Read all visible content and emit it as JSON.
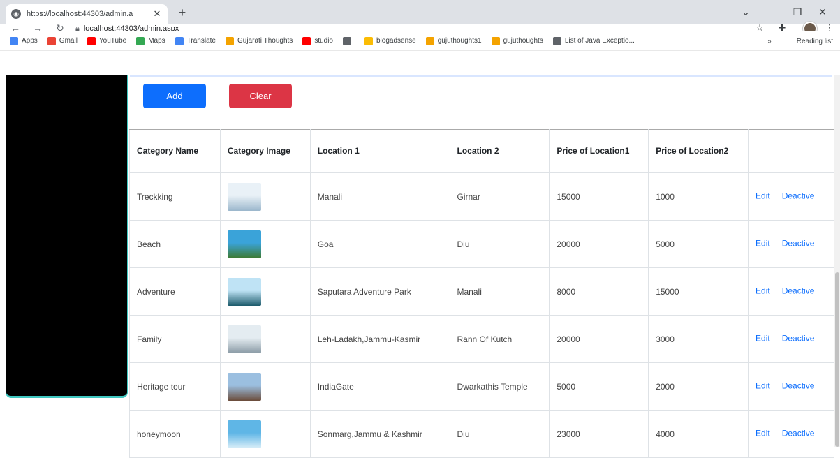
{
  "browser": {
    "tab_title": "https://localhost:44303/admin.a",
    "tab_close": "✕",
    "new_tab": "+",
    "url": "localhost:44303/admin.aspx",
    "window_controls": [
      "⌄",
      "–",
      "❐",
      "✕"
    ],
    "bookmarks": [
      {
        "label": "Apps",
        "icon": "apps-icon",
        "color": "#4285f4"
      },
      {
        "label": "Gmail",
        "icon": "gmail-icon",
        "color": "#ea4335"
      },
      {
        "label": "YouTube",
        "icon": "youtube-icon",
        "color": "#ff0000"
      },
      {
        "label": "Maps",
        "icon": "maps-icon",
        "color": "#34a853"
      },
      {
        "label": "Translate",
        "icon": "translate-icon",
        "color": "#4285f4"
      },
      {
        "label": "Gujarati Thoughts",
        "icon": "blogger-icon",
        "color": "#f4a300"
      },
      {
        "label": "studio",
        "icon": "youtube-studio-icon",
        "color": "#ff0000"
      },
      {
        "label": "",
        "icon": "globe-icon",
        "color": "#5f6368"
      },
      {
        "label": "blogadsense",
        "icon": "adsense-icon",
        "color": "#fbbc04"
      },
      {
        "label": "gujuthoughts1",
        "icon": "blogger-icon",
        "color": "#f4a300"
      },
      {
        "label": "gujuthoughts",
        "icon": "blogger-icon",
        "color": "#f4a300"
      },
      {
        "label": "List of Java Exceptio...",
        "icon": "java-icon",
        "color": "#5f6368"
      }
    ],
    "more_bookmarks": "»",
    "reading_list": "Reading list"
  },
  "actions": {
    "add_label": "Add",
    "clear_label": "Clear"
  },
  "table": {
    "headers": [
      "Category Name",
      "Category Image",
      "Location 1",
      "Location 2",
      "Price of Location1",
      "Price of Location2",
      ""
    ],
    "rows": [
      {
        "name": "Treckking",
        "loc1": "Manali",
        "loc2": "Girnar",
        "price1": "15000",
        "price2": "1000",
        "edit": "Edit",
        "deactive": "Deactive",
        "img_colors": [
          "#e9f1f7",
          "#9bb7cc"
        ]
      },
      {
        "name": "Beach",
        "loc1": "Goa",
        "loc2": "Diu",
        "price1": "20000",
        "price2": "5000",
        "edit": "Edit",
        "deactive": "Deactive",
        "img_colors": [
          "#3aa3d9",
          "#3d7a2f"
        ]
      },
      {
        "name": "Adventure",
        "loc1": "Saputara Adventure Park",
        "loc2": "Manali",
        "price1": "8000",
        "price2": "15000",
        "edit": "Edit",
        "deactive": "Deactive",
        "img_colors": [
          "#bfe3f5",
          "#1c5a6b"
        ]
      },
      {
        "name": "Family",
        "loc1": "Leh-Ladakh,Jammu-Kasmir",
        "loc2": "Rann Of Kutch",
        "price1": "20000",
        "price2": "3000",
        "edit": "Edit",
        "deactive": "Deactive",
        "img_colors": [
          "#e4ecf1",
          "#8a9aa5"
        ]
      },
      {
        "name": "Heritage tour",
        "loc1": "IndiaGate",
        "loc2": "Dwarkathis Temple",
        "price1": "5000",
        "price2": "2000",
        "edit": "Edit",
        "deactive": "Deactive",
        "img_colors": [
          "#9bbfe0",
          "#6b4c3a"
        ]
      },
      {
        "name": "honeymoon",
        "loc1": "Sonmarg,Jammu & Kashmir",
        "loc2": "Diu",
        "price1": "23000",
        "price2": "4000",
        "edit": "Edit",
        "deactive": "Deactive",
        "img_colors": [
          "#5fb6e6",
          "#d9eef8"
        ]
      }
    ]
  }
}
